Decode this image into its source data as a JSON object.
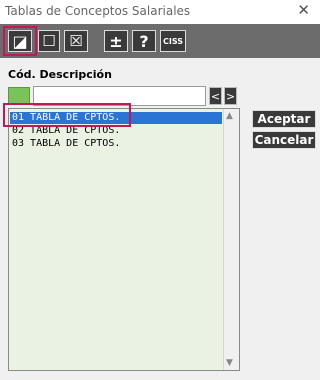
{
  "window": {
    "title": "Tablas de Conceptos Salariales",
    "close_glyph": "✕"
  },
  "toolbar": {
    "buttons": [
      {
        "name": "select-all-icon",
        "glyph": "◪"
      },
      {
        "name": "unchecked-box-icon",
        "glyph": "☐"
      },
      {
        "name": "checked-x-box-icon",
        "glyph": "☒"
      },
      {
        "name": "plus-minus-icon",
        "glyph": "±"
      },
      {
        "name": "help-question-icon",
        "glyph": "?"
      },
      {
        "name": "ciss-icon",
        "glyph": "CISS"
      }
    ]
  },
  "list_header": {
    "cod": "Cód.",
    "descripcion": "Descripción"
  },
  "search": {
    "value": "",
    "prev": "<",
    "next": ">"
  },
  "rows": [
    {
      "label": "01 TABLA DE CPTOS.",
      "selected": true
    },
    {
      "label": "02 TABLA DE CPTOS.",
      "selected": false
    },
    {
      "label": "03 TABLA DE CPTOS.",
      "selected": false
    }
  ],
  "scrollbar": {
    "up": "▲",
    "down": "▼"
  },
  "actions": {
    "accept": "Aceptar",
    "cancel": "Cancelar"
  },
  "colors": {
    "accent": "#c2185b",
    "selection": "#2c74d4",
    "list_bg": "#eaf3e3",
    "toolbar": "#6c6c6c",
    "green": "#78c45a"
  }
}
